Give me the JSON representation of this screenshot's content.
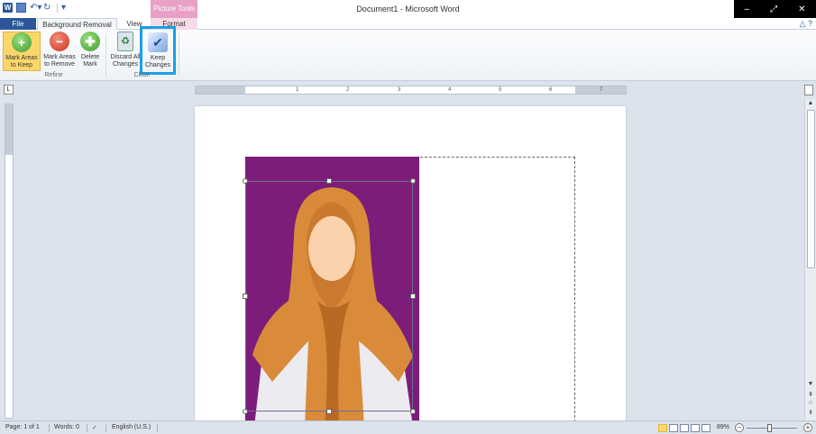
{
  "title_bar": {
    "document_title": "Document1 - Microsoft Word",
    "context_group": "Picture Tools",
    "app_icon": "word-logo-icon",
    "quick_access": [
      "save-icon",
      "undo-icon",
      "redo-icon",
      "customize-icon"
    ],
    "window_controls": [
      "minimize-icon",
      "restore-icon",
      "close-icon"
    ]
  },
  "tabs": {
    "file": "File",
    "background_removal": "Background Removal",
    "view": "View",
    "format": "Format"
  },
  "ribbon": {
    "mark_keep": "Mark Areas\nto Keep",
    "mark_keep_l1": "Mark Areas",
    "mark_keep_l2": "to Keep",
    "mark_remove_l1": "Mark Areas",
    "mark_remove_l2": "to Remove",
    "delete_l1": "Delete",
    "delete_l2": "Mark",
    "discard_l1": "Discard All",
    "discard_l2": "Changes",
    "keep_l1": "Keep",
    "keep_l2": "Changes",
    "group_refine": "Refine",
    "group_close": "Close"
  },
  "ruler": {
    "numbers": [
      "1",
      "2",
      "3",
      "4",
      "5",
      "6",
      "7"
    ]
  },
  "status": {
    "page": "Page: 1 of 1",
    "words": "Words: 0",
    "language": "English (U.S.)",
    "zoom": "89%"
  },
  "colors": {
    "accent": "#2b579a",
    "photo_background": "#7d1d7a",
    "highlight": "#1aa0e6",
    "active_button": "#fbd76b",
    "context_tab": "#e8a1c6"
  }
}
